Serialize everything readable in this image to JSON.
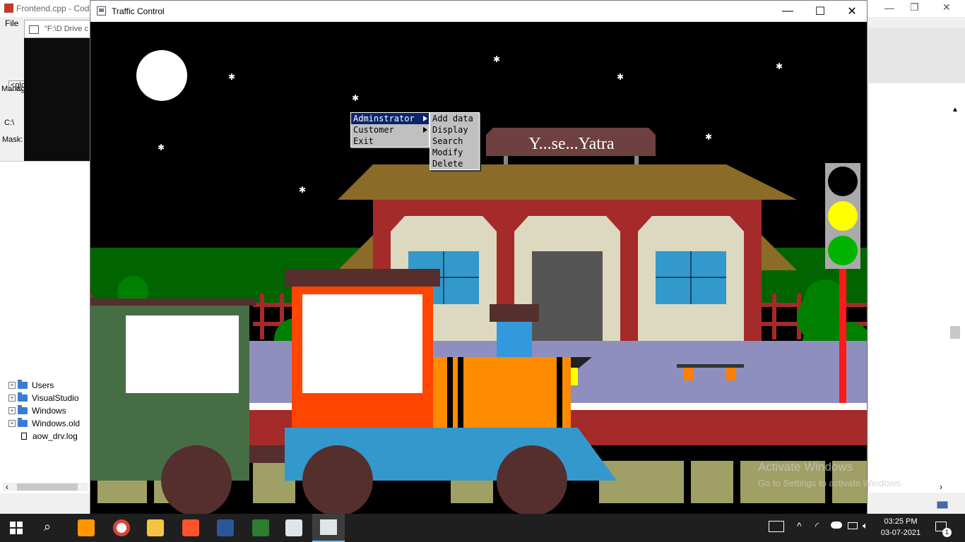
{
  "background_ide": {
    "title_fragment": "Frontend.cpp - Cod",
    "menu_file": "File",
    "console_title_fragment": "\"F:\\D Drive c",
    "globals_fragment": "<glo",
    "manager_fragment": "Manag",
    "path_fragment": "C:\\",
    "mask_label": "Mask:",
    "tree_items": [
      "Users",
      "VisualStudio",
      "Windows",
      "Windows.old",
      "aow_drv.log"
    ],
    "watermark_line1": "Activate Windows",
    "watermark_line2": "Go to Settings to activate Windows."
  },
  "window": {
    "title": "Traffic Control",
    "minimize_symbol": "—",
    "maximize_symbol": "☐",
    "close_symbol": "✕"
  },
  "scene": {
    "station_sign": "Y...se...Yatra",
    "traffic_light_colors": [
      "#000000",
      "#ffff00",
      "#00b400"
    ],
    "sky_color": "#000000",
    "roof_color": "#8b6b28",
    "station_wall_color": "#a52a2a",
    "platform_color": "#8f8fbf"
  },
  "menu": {
    "items": [
      {
        "label": "Adminstrator",
        "has_submenu": true,
        "active": true
      },
      {
        "label": "Customer",
        "has_submenu": true,
        "active": false
      },
      {
        "label": "Exit",
        "has_submenu": false,
        "active": false
      }
    ],
    "submenu": [
      "Add data",
      "Display",
      "Search",
      "Modify",
      "Delete"
    ]
  },
  "taskbar": {
    "time": "03:25 PM",
    "date": "03-07-2021",
    "notification_count": "1"
  }
}
